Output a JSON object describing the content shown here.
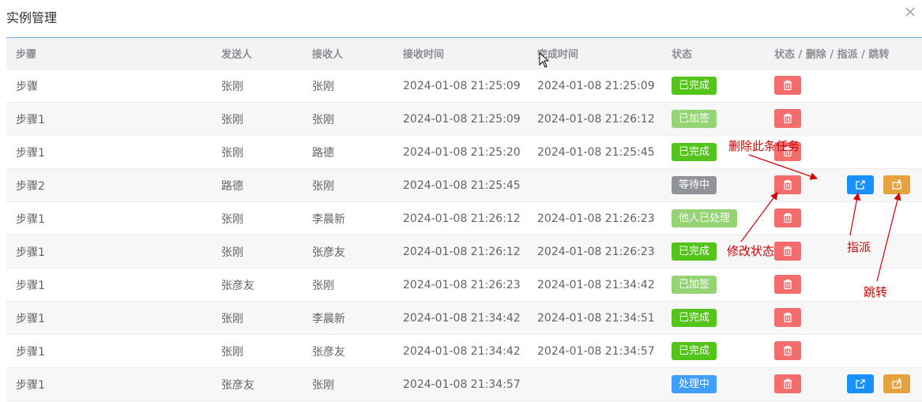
{
  "dialog": {
    "title": "实例管理"
  },
  "colors": {
    "header_rule": "#6aa8e8",
    "edit": "#1890ff",
    "delete": "#f56c6c",
    "assign": "#1890ff",
    "jump": "#e6a23c",
    "annotation": "#d40000"
  },
  "table": {
    "headers": [
      "步骤",
      "发送人",
      "接收人",
      "接收时间",
      "完成时间",
      "状态",
      "状态 / 删除 / 指派 / 跳转"
    ],
    "rows": [
      {
        "step": "步骤",
        "sender": "张刚",
        "receiver": "张刚",
        "received": "2024-01-08 21:25:09",
        "completed": "2024-01-08 21:25:09",
        "status": "已完成",
        "status_color": "#52c41a",
        "actions": [
          "edit",
          "delete"
        ]
      },
      {
        "step": "步骤1",
        "sender": "张刚",
        "receiver": "张刚",
        "received": "2024-01-08 21:25:09",
        "completed": "2024-01-08 21:26:12",
        "status": "已加签",
        "status_color": "#95d475",
        "actions": [
          "edit",
          "delete"
        ]
      },
      {
        "step": "步骤1",
        "sender": "张刚",
        "receiver": "路德",
        "received": "2024-01-08 21:25:20",
        "completed": "2024-01-08 21:25:45",
        "status": "已完成",
        "status_color": "#52c41a",
        "actions": [
          "edit",
          "delete"
        ]
      },
      {
        "step": "步骤2",
        "sender": "路德",
        "receiver": "张刚",
        "received": "2024-01-08 21:25:45",
        "completed": "",
        "status": "等待中",
        "status_color": "#909399",
        "actions": [
          "edit",
          "delete",
          "assign",
          "jump"
        ]
      },
      {
        "step": "步骤1",
        "sender": "张刚",
        "receiver": "李晨新",
        "received": "2024-01-08 21:26:12",
        "completed": "2024-01-08 21:26:23",
        "status": "他人已处理",
        "status_color": "#95d475",
        "actions": [
          "edit",
          "delete"
        ]
      },
      {
        "step": "步骤1",
        "sender": "张刚",
        "receiver": "张彦友",
        "received": "2024-01-08 21:26:12",
        "completed": "2024-01-08 21:26:23",
        "status": "已完成",
        "status_color": "#52c41a",
        "actions": [
          "edit",
          "delete"
        ]
      },
      {
        "step": "步骤1",
        "sender": "张彦友",
        "receiver": "张刚",
        "received": "2024-01-08 21:26:23",
        "completed": "2024-01-08 21:34:42",
        "status": "已加签",
        "status_color": "#95d475",
        "actions": [
          "edit",
          "delete"
        ]
      },
      {
        "step": "步骤1",
        "sender": "张刚",
        "receiver": "李晨新",
        "received": "2024-01-08 21:34:42",
        "completed": "2024-01-08 21:34:51",
        "status": "已完成",
        "status_color": "#52c41a",
        "actions": [
          "edit",
          "delete"
        ]
      },
      {
        "step": "步骤1",
        "sender": "张刚",
        "receiver": "张彦友",
        "received": "2024-01-08 21:34:42",
        "completed": "2024-01-08 21:34:57",
        "status": "已完成",
        "status_color": "#52c41a",
        "actions": [
          "edit",
          "delete"
        ]
      },
      {
        "step": "步骤1",
        "sender": "张彦友",
        "receiver": "张刚",
        "received": "2024-01-08 21:34:57",
        "completed": "",
        "status": "处理中",
        "status_color": "#409eff",
        "actions": [
          "edit",
          "delete",
          "assign",
          "jump"
        ]
      }
    ]
  },
  "annotations": {
    "delete": "删除此条任务",
    "edit": "修改状态",
    "assign": "指派",
    "jump": "跳转"
  }
}
